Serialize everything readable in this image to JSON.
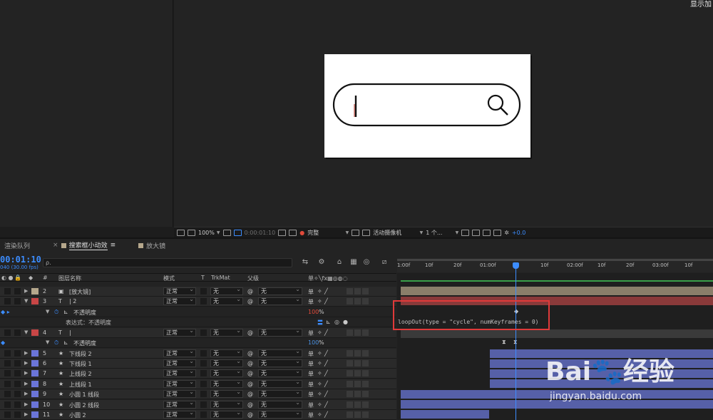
{
  "viewer": {
    "top_right_label": "显示加",
    "toolbar": {
      "zoom": "100%",
      "timecode": "0:00:01:10",
      "resolution": "完整",
      "camera": "活动摄像机",
      "views": "1 个...",
      "exposure": "+0.0"
    }
  },
  "timeline": {
    "tabs": [
      {
        "label": "渲染队列"
      },
      {
        "label": "搜索框小动效"
      },
      {
        "label": "放大镜"
      }
    ],
    "tab_menu_icon": "≡",
    "current_time": "00:01:10",
    "fps_note": "040 (30.00 fps)",
    "search_placeholder": "ρ.",
    "columns": {
      "number": "#",
      "layer_name": "图层名称",
      "mode": "模式",
      "t": "T",
      "trkmat": "TrkMat",
      "parent": "父级"
    },
    "ruler_labels": [
      "1:00f",
      "10f",
      "20f",
      "01:00f",
      "10f",
      "20f",
      "02:00f",
      "10f",
      "20f",
      "03:00f",
      "10f"
    ],
    "rows": [
      {
        "kind": "layer",
        "num": "2",
        "color": "#b5a78c",
        "type": "▣",
        "name": "[放大镜]",
        "mode": "正常",
        "trkmat": "无",
        "parent": "无"
      },
      {
        "kind": "layer",
        "num": "3",
        "color": "#c84646",
        "type": "T",
        "name": "| 2",
        "mode": "正常",
        "trkmat": "无",
        "parent": "无"
      },
      {
        "kind": "prop",
        "label": "不透明度",
        "value": "100",
        "unit": "%"
      },
      {
        "kind": "expr",
        "label": "表达式：不透明度"
      },
      {
        "kind": "layer",
        "num": "4",
        "color": "#c84646",
        "type": "T",
        "name": "|",
        "mode": "正常",
        "trkmat": "无",
        "parent": "无"
      },
      {
        "kind": "prop",
        "label": "不透明度",
        "value": "100",
        "unit": "%"
      },
      {
        "kind": "layer",
        "num": "5",
        "color": "#6b75d8",
        "type": "★",
        "name": "下线段 2",
        "mode": "正常",
        "trkmat": "无",
        "parent": "无"
      },
      {
        "kind": "layer",
        "num": "6",
        "color": "#6b75d8",
        "type": "★",
        "name": "下线段 1",
        "mode": "正常",
        "trkmat": "无",
        "parent": "无"
      },
      {
        "kind": "layer",
        "num": "7",
        "color": "#6b75d8",
        "type": "★",
        "name": "上线段 2",
        "mode": "正常",
        "trkmat": "无",
        "parent": "无"
      },
      {
        "kind": "layer",
        "num": "8",
        "color": "#6b75d8",
        "type": "★",
        "name": "上线段 1",
        "mode": "正常",
        "trkmat": "无",
        "parent": "无"
      },
      {
        "kind": "layer",
        "num": "9",
        "color": "#6b75d8",
        "type": "★",
        "name": "小圆 1 线段",
        "mode": "正常",
        "trkmat": "无",
        "parent": "无"
      },
      {
        "kind": "layer",
        "num": "10",
        "color": "#6b75d8",
        "type": "★",
        "name": "小圆 2 线段",
        "mode": "正常",
        "trkmat": "无",
        "parent": "无"
      },
      {
        "kind": "layer",
        "num": "11",
        "color": "#6b75d8",
        "type": "★",
        "name": "小圆 2",
        "mode": "正常",
        "trkmat": "无",
        "parent": "无"
      }
    ],
    "expression": "loopOut(type = \"cycle\", numKeyframes = 0)"
  },
  "watermark": {
    "brand": "Bai",
    "brand2": "经验",
    "url": "jingyan.baidu.com"
  }
}
